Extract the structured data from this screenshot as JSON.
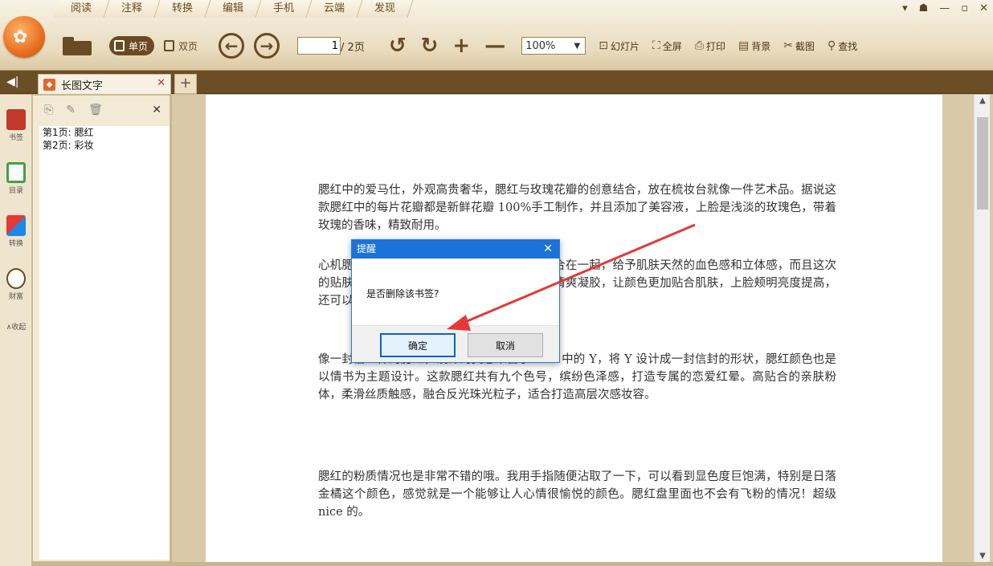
{
  "menu": [
    "阅读",
    "注释",
    "转换",
    "编辑",
    "手机",
    "云端",
    "发现"
  ],
  "window_controls": [
    "▾",
    "☗",
    "—",
    "▫",
    "✕"
  ],
  "toolbar": {
    "single_page": "单页",
    "double_page": "双页",
    "page_current": "1",
    "page_total": "/ 2页",
    "zoom": "100%",
    "slideshow": "幻灯片",
    "fullscreen": "全屏",
    "print": "打印",
    "background": "背景",
    "screenshot": "截图",
    "find": "查找"
  },
  "tab": {
    "title": "长图文字",
    "add": "+"
  },
  "rail": {
    "bookmark": "书签",
    "toc": "目录",
    "convert": "转换",
    "wealth": "财富",
    "collapse": "∧收起"
  },
  "bookmarks": [
    "第1页: 腮红",
    "第2页: 彩妆"
  ],
  "document": {
    "p1": "腮红中的爱马仕，外观高贵奢华，腮红与玫瑰花瓣的创意结合，放在梳妆台就像一件艺术品。据说这款腮红中的每片花瓣都是新鲜花瓣 100%手工制作，并且添加了美容液，上脸是浅淡的玫瑰色，带着玫瑰的香味，精致耐用。",
    "p2": "心机腮红采用了五种颜色，这次的五种颜色综合在一起，给予肌肤天然的血色感和立体感，而且这次的贴肤帖度更高，还加入了能配合表情变化的清爽凝胶，让颜色更加贴合肌肤，上脸颊明亮度提高，还可以修饰脸型，让脸部自然好看。",
    "p3": "像一封信一样的腮红，设计的灵感来自于 YSL 中的 Y，将 Y 设计成一封信封的形状，腮红颜色也是以情书为主题设计。这款腮红共有九个色号，缤纷色泽感，打造专属的恋爱红晕。高贴合的亲肤粉体，柔滑丝质触感，融合反光珠光粒子，适合打造高层次感妆容。",
    "p4": "腮红的粉质情况也是非常不错的哦。我用手指随便沾取了一下，可以看到显色度巨饱满，特别是日落金橘这个颜色，感觉就是一个能够让人心情很愉悦的颜色。腮红盘里面也不会有飞粉的情况！超级 nice 的。"
  },
  "dialog": {
    "title": "提醒",
    "message": "是否删除该书签?",
    "ok": "确定",
    "cancel": "取消"
  },
  "colors": {
    "accent": "#6a4a22",
    "dialog_title": "#1b72d8",
    "annotation_arrow": "#e53935"
  }
}
